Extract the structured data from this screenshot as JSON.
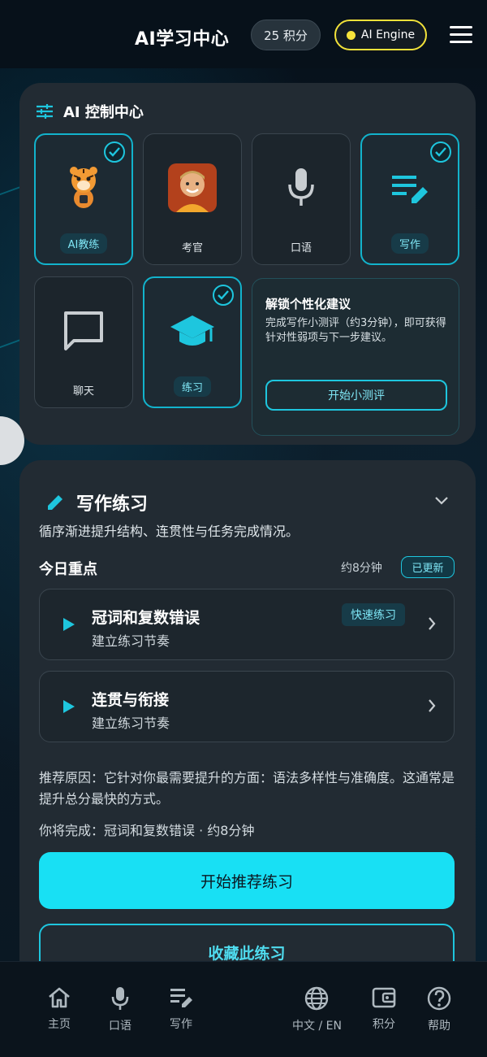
{
  "header": {
    "title": "AI学习中心",
    "points": "25 积分",
    "engine_label": "AI Engine"
  },
  "control_panel": {
    "title": "AI 控制中心",
    "tiles": [
      {
        "label": "AI教练",
        "selected": true
      },
      {
        "label": "考官",
        "selected": false
      },
      {
        "label": "口语",
        "selected": false
      },
      {
        "label": "写作",
        "selected": true
      },
      {
        "label": "聊天",
        "selected": false
      },
      {
        "label": "练习",
        "selected": true
      }
    ],
    "unlock": {
      "title": "解锁个性化建议",
      "description": "完成写作小测评（约3分钟），即可获得针对性弱项与下一步建议。",
      "button": "开始小测评"
    }
  },
  "writing": {
    "title": "写作练习",
    "subtitle": "循序渐进提升结构、连贯性与任务完成情况。",
    "focus_title": "今日重点",
    "focus_time": "约8分钟",
    "updated_badge": "已更新",
    "lessons": [
      {
        "name": "冠词和复数错误",
        "sub": "建立练习节奏",
        "tag": "快速练习"
      },
      {
        "name": "连贯与衔接",
        "sub": "建立练习节奏",
        "tag": ""
      }
    ],
    "reason": "推荐原因：它针对你最需要提升的方面：语法多样性与准确度。这通常是提升总分最快的方式。",
    "finish": "你将完成：冠词和复数错误 · 约8分钟",
    "primary_button": "开始推荐练习",
    "secondary_button": "收藏此练习"
  },
  "nav": {
    "home": "主页",
    "speaking": "口语",
    "writing": "写作",
    "language": "中文 / EN",
    "points": "积分",
    "help": "帮助"
  },
  "colors": {
    "accent": "#18e0f4",
    "engine_indicator": "#f7e33b",
    "panel_bg": "#222b33"
  }
}
